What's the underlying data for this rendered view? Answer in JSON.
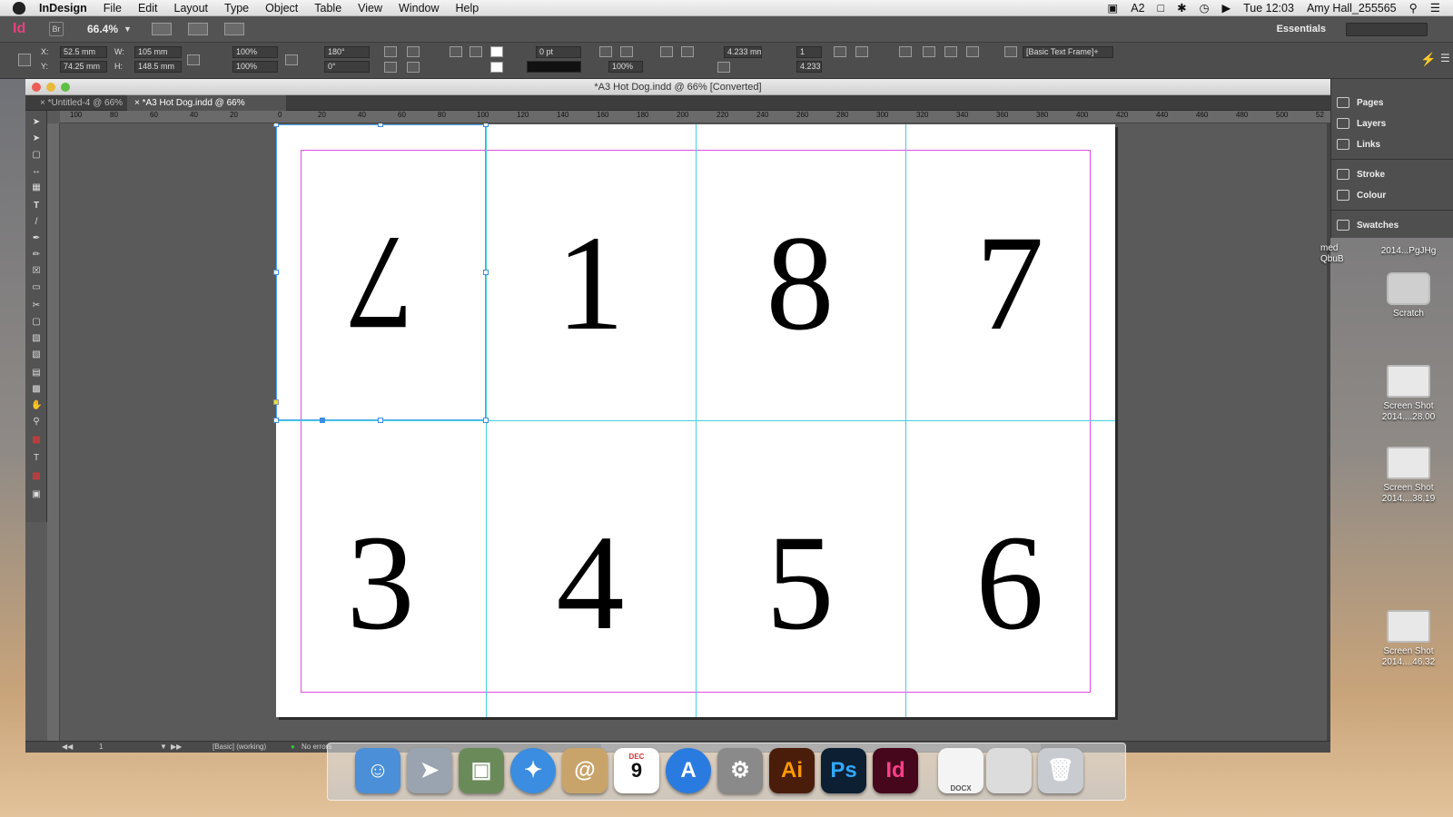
{
  "menubar": {
    "app_name": "InDesign",
    "items": [
      "File",
      "Edit",
      "Layout",
      "Type",
      "Object",
      "Table",
      "View",
      "Window",
      "Help"
    ],
    "status_adobe_badge": "2",
    "clock": "Tue 12:03",
    "user": "Amy Hall_255565"
  },
  "appbar": {
    "logo": "Id",
    "bridge": "Br",
    "zoom": "66.4%",
    "workspace": "Essentials"
  },
  "control": {
    "x": "52.5 mm",
    "y": "74.25 mm",
    "w": "105 mm",
    "h": "148.5 mm",
    "scale_x": "100%",
    "scale_y": "100%",
    "rotate": "180°",
    "shear": "0°",
    "stroke_weight": "0 pt",
    "opacity": "100%",
    "x_label": "X:",
    "y_label": "Y:",
    "w_label": "W:",
    "h_label": "H:",
    "offset_a": "4.233 mm",
    "offset_b": "4.233 r",
    "columns": "1",
    "style": "[Basic Text Frame]+"
  },
  "window": {
    "title": "*A3 Hot Dog.indd @ 66% [Converted]",
    "tabs": [
      {
        "label": "*Untitled-4 @ 66%"
      },
      {
        "label": "*A3 Hot Dog.indd @ 66% [Converted]"
      }
    ]
  },
  "ruler": [
    "100",
    "80",
    "60",
    "40",
    "20",
    "0",
    "20",
    "40",
    "60",
    "80",
    "100",
    "120",
    "140",
    "160",
    "180",
    "200",
    "220",
    "240",
    "260",
    "280",
    "300",
    "320",
    "340",
    "360",
    "380",
    "400",
    "420",
    "440",
    "460",
    "480",
    "500",
    "52"
  ],
  "page_numbers": {
    "top": [
      "7",
      "1",
      "8",
      "7"
    ],
    "bottom": [
      "3",
      "4",
      "5",
      "6"
    ]
  },
  "status": {
    "page": "1",
    "preflight_profile": "[Basic] (working)",
    "errors": "No errors"
  },
  "panels": [
    "Pages",
    "Layers",
    "Links",
    "Stroke",
    "Colour",
    "Swatches"
  ],
  "desktop": [
    {
      "line1": "med",
      "line2": "QbuB"
    },
    {
      "line1": "2014...PgJHg",
      "line2": ""
    },
    {
      "line1": "Scratch",
      "line2": ""
    },
    {
      "line1": "Screen Shot",
      "line2": "2014....28.00"
    },
    {
      "line1": "Screen Shot",
      "line2": "2014....38.19"
    },
    {
      "line1": "Screen Shot",
      "line2": "2014....46.32"
    }
  ],
  "dock": {
    "ai": "Ai",
    "ps": "Ps",
    "id": "Id",
    "calendar_month": "DEC",
    "calendar_day": "9",
    "docx_label": "DOCX"
  }
}
